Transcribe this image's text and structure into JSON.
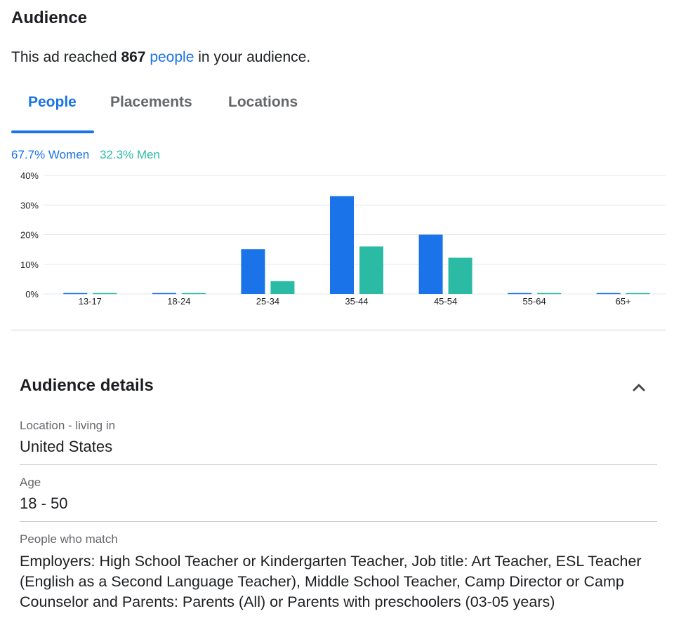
{
  "audience": {
    "title": "Audience",
    "reach_prefix": "This ad reached",
    "reach_count": "867",
    "reach_link": "people",
    "reach_suffix": "in your audience."
  },
  "tabs": [
    {
      "label": "People",
      "active": true
    },
    {
      "label": "Placements",
      "active": false
    },
    {
      "label": "Locations",
      "active": false
    }
  ],
  "gender": {
    "women": "67.7% Women",
    "men": "32.3% Men"
  },
  "colors": {
    "women": "#1a73e8",
    "men": "#2bbba4",
    "accent": "#1a73e8"
  },
  "chart_data": {
    "type": "bar",
    "categories": [
      "13-17",
      "18-24",
      "25-34",
      "35-44",
      "45-54",
      "55-64",
      "65+"
    ],
    "series": [
      {
        "name": "Women",
        "values": [
          0.3,
          0.3,
          15.1,
          33.0,
          20.0,
          0.3,
          0.3
        ]
      },
      {
        "name": "Men",
        "values": [
          0.3,
          0.3,
          4.3,
          16.0,
          12.2,
          0.3,
          0.3
        ]
      }
    ],
    "yticks": [
      "0%",
      "10%",
      "20%",
      "30%",
      "40%"
    ],
    "ylim": [
      0,
      40
    ],
    "grid": true,
    "legend": "top-left"
  },
  "details": {
    "title": "Audience details",
    "chevron_icon": "chevron-up-icon",
    "location_label": "Location - living in",
    "location_value": "United States",
    "age_label": "Age",
    "age_value": "18 - 50",
    "match_label": "People who match",
    "match_value": "Employers: High School Teacher or Kindergarten Teacher, Job title: Art Teacher, ESL Teacher (English as a Second Language Teacher), Middle School Teacher, Camp Director or Camp Counselor and Parents: Parents (All) or Parents with preschoolers (03-05 years)"
  }
}
